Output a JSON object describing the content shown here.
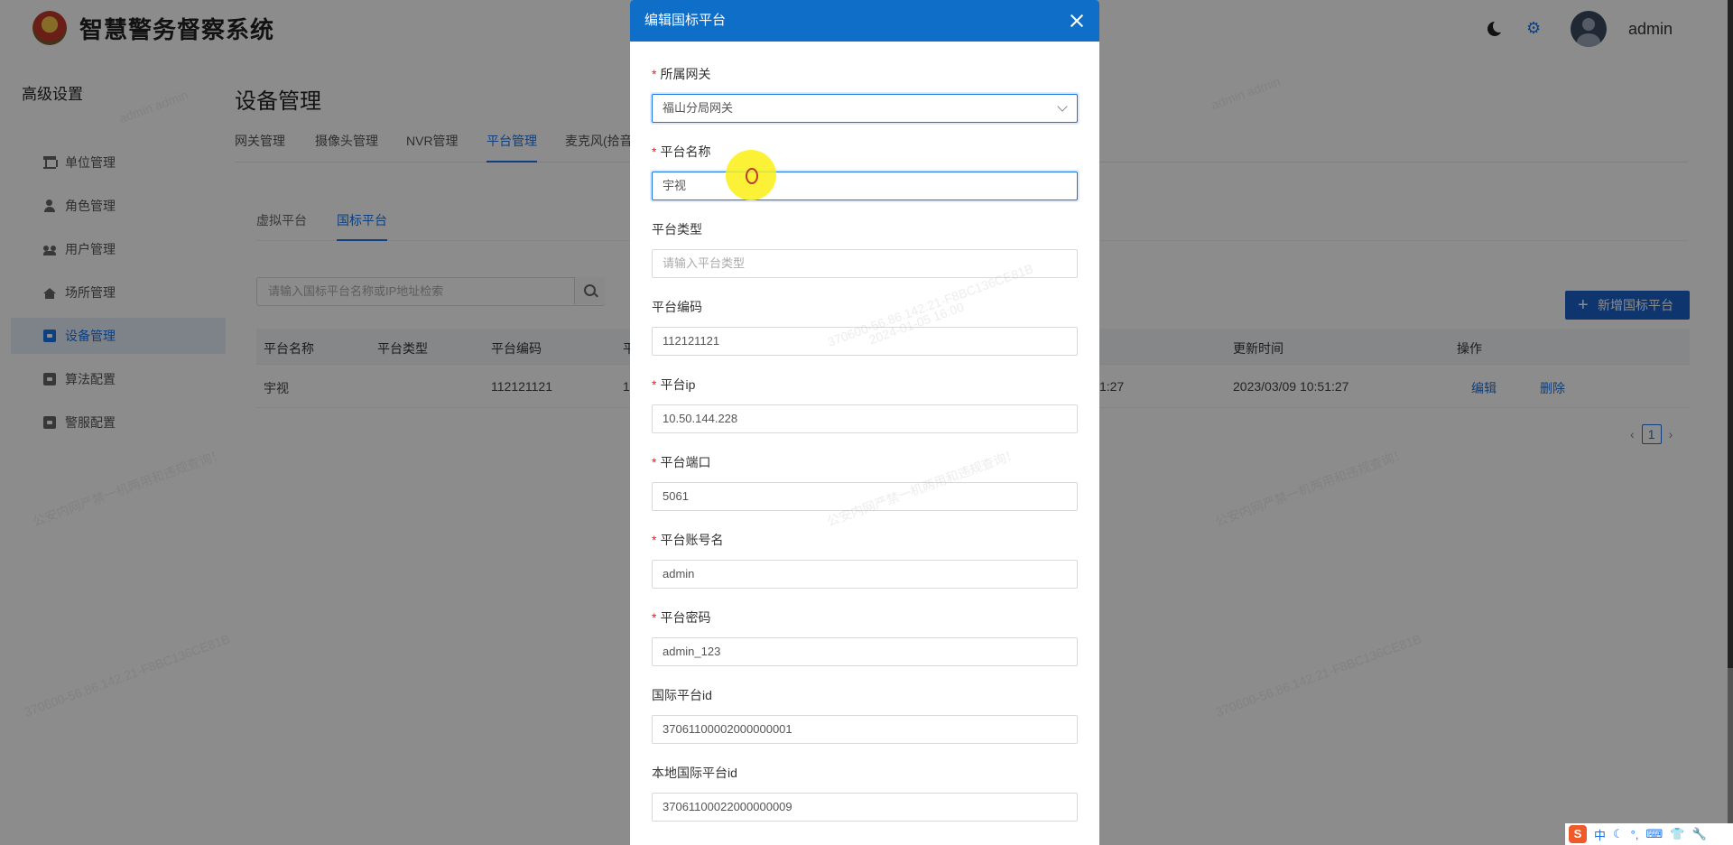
{
  "app": {
    "title": "智慧警务督察系统",
    "username": "admin"
  },
  "sidebar": {
    "title": "高级设置",
    "items": [
      {
        "label": "单位管理",
        "icon": "bank-icon"
      },
      {
        "label": "角色管理",
        "icon": "user-icon"
      },
      {
        "label": "用户管理",
        "icon": "users-icon"
      },
      {
        "label": "场所管理",
        "icon": "building-icon"
      },
      {
        "label": "设备管理",
        "icon": "device-icon",
        "active": true
      },
      {
        "label": "算法配置",
        "icon": "algorithm-icon"
      },
      {
        "label": "警服配置",
        "icon": "uniform-icon"
      }
    ]
  },
  "main": {
    "page_title": "设备管理",
    "tabs": [
      "网关管理",
      "摄像头管理",
      "NVR管理",
      "平台管理",
      "麦克风(拾音"
    ],
    "active_tab": "平台管理",
    "sub_tabs": [
      "虚拟平台",
      "国标平台"
    ],
    "active_sub_tab": "国标平台",
    "search_placeholder": "请输入国标平台名称或IP地址检索",
    "add_button": "新增国标平台",
    "table": {
      "headers": [
        "平台名称",
        "平台类型",
        "平台编码",
        "平",
        "更新时间",
        "操作"
      ],
      "rows": [
        {
          "name": "宇视",
          "type": "",
          "code": "112121121",
          "col4": "1",
          "created_tail": "1:27",
          "updated": "2023/03/09 10:51:27",
          "edit": "编辑",
          "delete": "删除"
        }
      ]
    },
    "pager": {
      "current": "1"
    }
  },
  "modal": {
    "title": "编辑国标平台",
    "fields": [
      {
        "label": "所属网关",
        "required": true,
        "value": "福山分局网关",
        "type": "select"
      },
      {
        "label": "平台名称",
        "required": true,
        "value": "宇视",
        "focused": true
      },
      {
        "label": "平台类型",
        "required": false,
        "placeholder": "请输入平台类型"
      },
      {
        "label": "平台编码",
        "required": false,
        "value": "112121121"
      },
      {
        "label": "平台ip",
        "required": true,
        "value": "10.50.144.228"
      },
      {
        "label": "平台端口",
        "required": true,
        "value": "5061"
      },
      {
        "label": "平台账号名",
        "required": true,
        "value": "admin"
      },
      {
        "label": "平台密码",
        "required": true,
        "value": "admin_123"
      },
      {
        "label": "国际平台id",
        "required": false,
        "value": "37061100002000000001"
      },
      {
        "label": "本地国际平台id",
        "required": false,
        "value": "37061100022000000009"
      }
    ]
  },
  "watermark": {
    "line1": "admin admin",
    "line2": "公安内网严禁一机两用和违规查询！",
    "line3": "370600-56.86.142.21-F8BC136CE81B",
    "line4": "2024-01-05 16:00"
  },
  "tray": {
    "ime": "中"
  },
  "colors": {
    "primary": "#1a73e8",
    "header": "#0f6ec8",
    "required": "#e02020"
  }
}
